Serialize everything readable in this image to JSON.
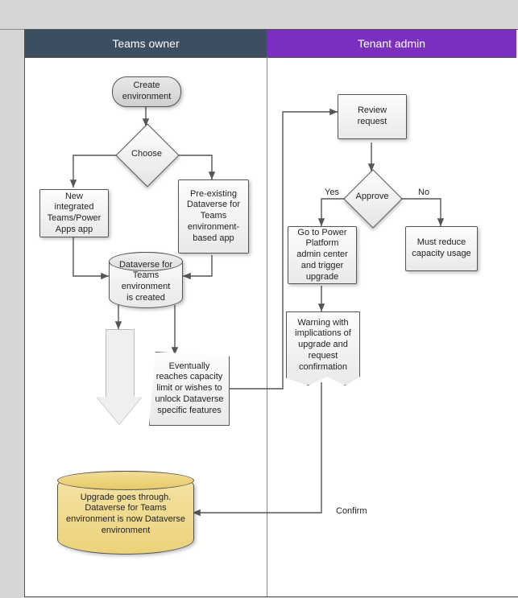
{
  "lanes": {
    "left": {
      "title": "Teams owner"
    },
    "right": {
      "title": "Tenant admin"
    }
  },
  "nodes": {
    "create_env": "Create environment",
    "choose": "Choose",
    "new_app": "New integrated Teams/Power Apps app",
    "preexisting": "Pre-existing Dataverse for Teams environment-based app",
    "dv_created": "Dataverse for Teams environment is created",
    "eventually": "Eventually reaches capacity limit or wishes to unlock Dataverse specific features",
    "upgrade_done": "Upgrade goes through. Dataverse for Teams environment is now Dataverse environment",
    "review": "Review request",
    "approve": "Approve",
    "go_admin": "Go to Power Platform admin center and trigger upgrade",
    "must_reduce": "Must reduce capacity usage",
    "warning": "Warning with implications of upgrade and request confirmation"
  },
  "edge_labels": {
    "yes": "Yes",
    "no": "No",
    "confirm": "Confirm"
  }
}
